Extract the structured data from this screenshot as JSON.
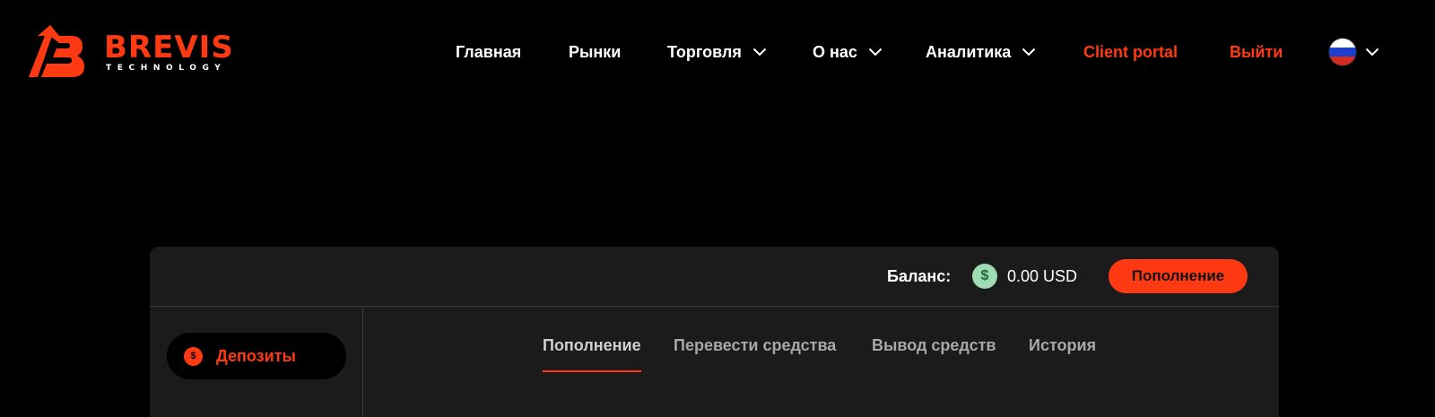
{
  "brand": {
    "name": "BREVIS",
    "tagline": "TECHNOLOGY"
  },
  "nav": {
    "items": [
      {
        "label": "Главная",
        "has_dropdown": false
      },
      {
        "label": "Рынки",
        "has_dropdown": false
      },
      {
        "label": "Торговля",
        "has_dropdown": true
      },
      {
        "label": "О нас",
        "has_dropdown": true
      },
      {
        "label": "Аналитика",
        "has_dropdown": true
      },
      {
        "label": "Client portal",
        "has_dropdown": false
      },
      {
        "label": "Выйти",
        "has_dropdown": false
      }
    ],
    "language": "ru"
  },
  "balance": {
    "label": "Баланс:",
    "currency_icon": "$",
    "value": "0.00 USD",
    "topup_button": "Пополнение"
  },
  "sidebar": {
    "items": [
      {
        "icon": "$",
        "label": "Депозиты",
        "active": true
      }
    ]
  },
  "tabs": [
    {
      "label": "Пополнение",
      "active": true
    },
    {
      "label": "Перевести средства",
      "active": false
    },
    {
      "label": "Вывод средств",
      "active": false
    },
    {
      "label": "История",
      "active": false
    }
  ],
  "colors": {
    "accent": "#ff3a12",
    "background": "#000000",
    "panel": "#1b1b1b",
    "coin": "#9fdcb3",
    "tab_inactive": "#a8a8a8"
  },
  "icons": {
    "logo": "brevis-b-arrow-logo",
    "dropdown": "chevron-down-icon",
    "language": "russia-flag-icon",
    "balance": "dollar-coin-icon",
    "sidebar_deposit": "dollar-circle-icon"
  }
}
